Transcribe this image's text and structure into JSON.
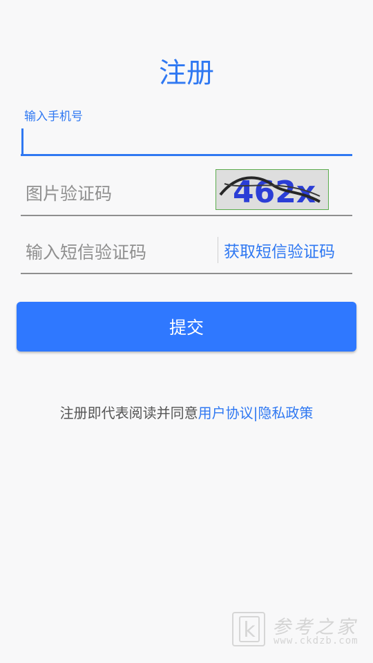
{
  "page": {
    "title": "注册"
  },
  "phone": {
    "label": "输入手机号",
    "value": ""
  },
  "captcha": {
    "placeholder": "图片验证码",
    "image_text": "462x"
  },
  "sms": {
    "placeholder": "输入短信验证码",
    "get_code_label": "获取短信验证码"
  },
  "submit": {
    "label": "提交"
  },
  "agreement": {
    "prefix": "注册即代表阅读并同意",
    "user_agreement": "用户协议",
    "separator": "|",
    "privacy_policy": "隐私政策"
  },
  "watermark": {
    "icon_letter": "k",
    "site_name": "参考之家",
    "url": "www.ckdzb.com"
  },
  "colors": {
    "accent": "#2f78f2",
    "button": "#2f78ff",
    "background": "#f8f8f9",
    "captcha_border": "#5aab4c"
  }
}
